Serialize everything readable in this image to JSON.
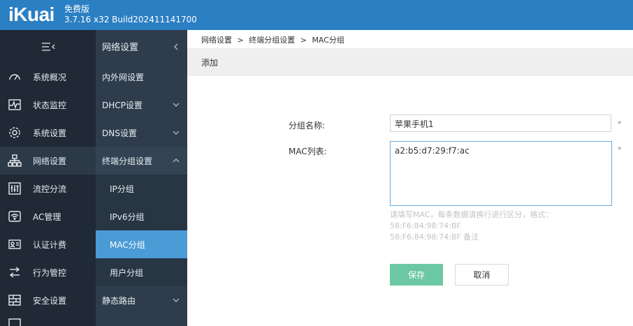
{
  "header": {
    "logo": "iKuai",
    "edition": "免费版",
    "version": "3.7.16 x32 Build202411141700"
  },
  "sidebar": {
    "toggle_icon": "≡<",
    "items": [
      {
        "label": "系统概况",
        "icon": "dashboard-icon"
      },
      {
        "label": "状态监控",
        "icon": "pulse-icon"
      },
      {
        "label": "系统设置",
        "icon": "gear-icon"
      },
      {
        "label": "网络设置",
        "icon": "network-icon"
      },
      {
        "label": "流控分流",
        "icon": "sliders-icon"
      },
      {
        "label": "AC管理",
        "icon": "wifi-icon"
      },
      {
        "label": "认证计费",
        "icon": "id-card-icon"
      },
      {
        "label": "行为管控",
        "icon": "arrows-icon"
      },
      {
        "label": "安全设置",
        "icon": "firewall-icon"
      }
    ]
  },
  "submenu": {
    "title": "网络设置",
    "items": [
      {
        "label": "内外网设置"
      },
      {
        "label": "DHCP设置"
      },
      {
        "label": "DNS设置"
      },
      {
        "label": "终端分组设置"
      },
      {
        "label": "IP分组"
      },
      {
        "label": "IPv6分组"
      },
      {
        "label": "MAC分组"
      },
      {
        "label": "用户分组"
      },
      {
        "label": "静态路由"
      }
    ]
  },
  "breadcrumb": [
    "网络设置",
    ">",
    "终端分组设置",
    ">",
    "MAC分组"
  ],
  "page": {
    "title": "添加",
    "group_name_label": "分组名称:",
    "group_name_value": "苹果手机1",
    "mac_list_label": "MAC列表:",
    "mac_list_value": "a2:b5:d7:29:f7:ac",
    "required_mark": "*",
    "hint_line1": "请填写MAC，每条数据请换行进行区分，格式：",
    "hint_line2": "58:F6:84:98:74:BF",
    "hint_line3": "58:F6:84:98:74:BF 备注",
    "save_label": "保存",
    "cancel_label": "取消"
  },
  "colors": {
    "header": "#2b7fc3",
    "sidebar": "#1f2a36",
    "submenu": "#2e3c4b",
    "selected": "#4a9bd6",
    "save_button": "#6cc7a4"
  }
}
